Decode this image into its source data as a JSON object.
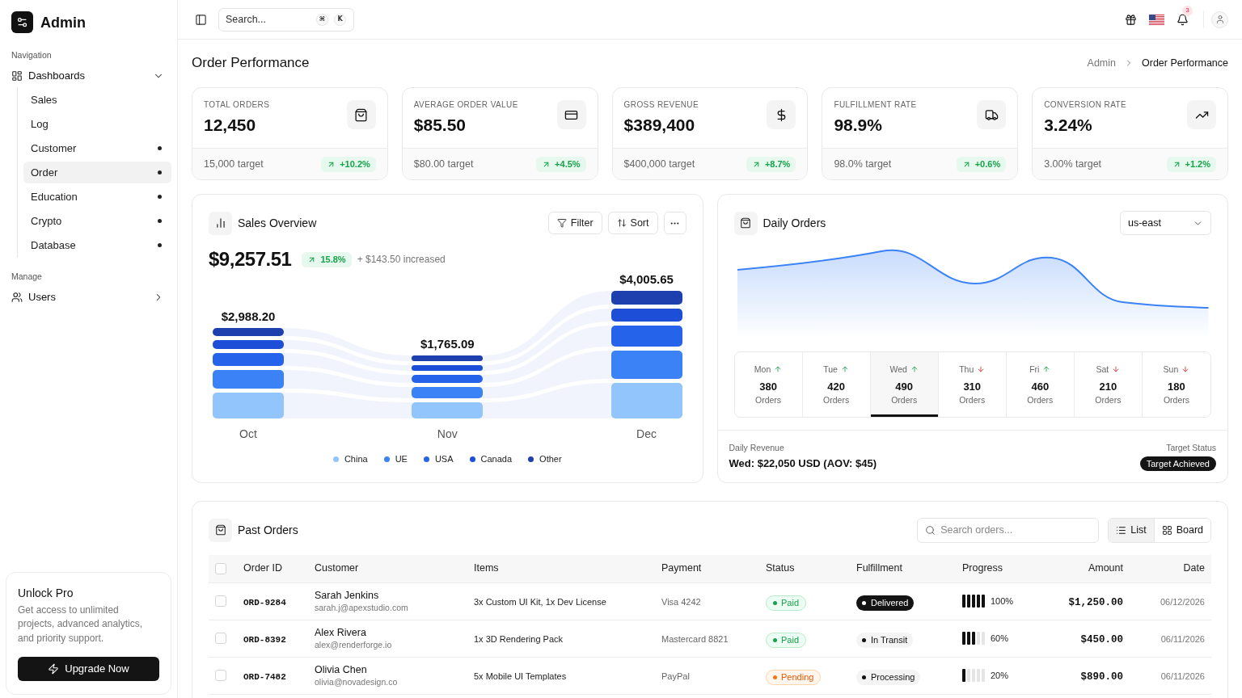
{
  "sidebar": {
    "brand": "Admin",
    "sections": [
      {
        "title": "Navigation",
        "items": [
          {
            "label": "Dashboards",
            "expanded": true,
            "children": [
              {
                "label": "Sales",
                "dot": false,
                "selected": false
              },
              {
                "label": "Log",
                "dot": false,
                "selected": false
              },
              {
                "label": "Customer",
                "dot": true,
                "selected": false
              },
              {
                "label": "Order",
                "dot": true,
                "selected": true
              },
              {
                "label": "Education",
                "dot": true,
                "selected": false
              },
              {
                "label": "Crypto",
                "dot": true,
                "selected": false
              },
              {
                "label": "Database",
                "dot": true,
                "selected": false
              }
            ]
          }
        ]
      },
      {
        "title": "Manage",
        "items": [
          {
            "label": "Users",
            "expanded": false
          }
        ]
      }
    ],
    "promo": {
      "title": "Unlock Pro",
      "text": "Get access to unlimited projects, advanced analytics, and priority support.",
      "button": "Upgrade Now"
    }
  },
  "header": {
    "search": {
      "placeholder": "Search...",
      "shortcut": [
        "⌘",
        "K"
      ]
    },
    "notifications": {
      "count": "3"
    }
  },
  "page": {
    "title": "Order Performance",
    "breadcrumb": [
      {
        "label": "Admin",
        "current": false
      },
      {
        "label": "Order Performance",
        "current": true
      }
    ]
  },
  "kpis": [
    {
      "label": "TOTAL ORDERS",
      "value": "12,450",
      "target": "15,000 target",
      "change": "+10.2%",
      "rising": true
    },
    {
      "label": "AVERAGE ORDER VALUE",
      "value": "$85.50",
      "target": "$80.00 target",
      "change": "+4.5%",
      "rising": true
    },
    {
      "label": "GROSS REVENUE",
      "value": "$389,400",
      "target": "$400,000 target",
      "change": "+8.7%",
      "rising": true
    },
    {
      "label": "FULFILLMENT RATE",
      "value": "98.9%",
      "target": "98.0% target",
      "change": "+0.6%",
      "rising": true
    },
    {
      "label": "CONVERSION RATE",
      "value": "3.24%",
      "target": "3.00% target",
      "change": "+1.2%",
      "rising": true
    }
  ],
  "sales_overview": {
    "title": "Sales Overview",
    "actions": [
      "Filter",
      "Sort"
    ],
    "total": "$9,257.51",
    "change": "15.8%",
    "rising": true,
    "note": "+ $143.50 increased",
    "columns": [
      {
        "label": "Oct",
        "total": "$2,988.20"
      },
      {
        "label": "Nov",
        "total": "$1,765.09"
      },
      {
        "label": "Dec",
        "total": "$4,005.65"
      }
    ],
    "legend": [
      {
        "label": "China",
        "color": "#93c5fd"
      },
      {
        "label": "UE",
        "color": "#3b82f6"
      },
      {
        "label": "USA",
        "color": "#2563eb"
      },
      {
        "label": "Canada",
        "color": "#1d4ed8"
      },
      {
        "label": "Other",
        "color": "#1e40af"
      }
    ]
  },
  "daily_orders": {
    "title": "Daily Orders",
    "region": {
      "value": "us-east"
    },
    "days": [
      {
        "day": "Mon",
        "rising": true,
        "count": "380",
        "unit": "Orders",
        "selected": false
      },
      {
        "day": "Tue",
        "rising": true,
        "count": "420",
        "unit": "Orders",
        "selected": false
      },
      {
        "day": "Wed",
        "rising": true,
        "count": "490",
        "unit": "Orders",
        "selected": true
      },
      {
        "day": "Thu",
        "rising": false,
        "count": "310",
        "unit": "Orders",
        "selected": false
      },
      {
        "day": "Fri",
        "rising": true,
        "count": "460",
        "unit": "Orders",
        "selected": false
      },
      {
        "day": "Sat",
        "rising": false,
        "count": "210",
        "unit": "Orders",
        "selected": false
      },
      {
        "day": "Sun",
        "rising": false,
        "count": "180",
        "unit": "Orders",
        "selected": false
      }
    ],
    "footer": {
      "label": "Daily Revenue",
      "value": "Wed: $22,050 USD (AOV: $45)",
      "status_label": "Target Status",
      "status": "Target Achieved"
    }
  },
  "past_orders": {
    "title": "Past Orders",
    "search": {
      "placeholder": "Search orders..."
    },
    "views": [
      {
        "label": "List",
        "selected": true
      },
      {
        "label": "Board",
        "selected": false
      }
    ],
    "table": {
      "all_checked": false,
      "columns": [
        "Order ID",
        "Customer",
        "Items",
        "Payment",
        "Status",
        "Fulfillment",
        "Progress",
        "Amount",
        "Date"
      ],
      "rows": [
        {
          "checked": false,
          "order_id": "ORD-9284",
          "customer": "Sarah Jenkins",
          "email": "sarah.j@apexstudio.com",
          "items": "3x Custom UI Kit, 1x Dev License",
          "payment": "Visa 4242",
          "status": {
            "label": "Paid",
            "kind": "paid"
          },
          "fulfillment": {
            "label": "Delivered",
            "kind": "delivered"
          },
          "progress": {
            "level": 1,
            "label": "100%"
          },
          "amount": "$1,250.00",
          "date": "06/12/2026"
        },
        {
          "checked": false,
          "order_id": "ORD-8392",
          "customer": "Alex Rivera",
          "email": "alex@renderforge.io",
          "items": "1x 3D Rendering Pack",
          "payment": "Mastercard 8821",
          "status": {
            "label": "Paid",
            "kind": "paid"
          },
          "fulfillment": {
            "label": "In Transit",
            "kind": "in_transit"
          },
          "progress": {
            "level": 0.6,
            "label": "60%"
          },
          "amount": "$450.00",
          "date": "06/11/2026"
        },
        {
          "checked": false,
          "order_id": "ORD-7482",
          "customer": "Olivia Chen",
          "email": "olivia@novadesign.co",
          "items": "5x Mobile UI Templates",
          "payment": "PayPal",
          "status": {
            "label": "Pending",
            "kind": "pending"
          },
          "fulfillment": {
            "label": "Processing",
            "kind": "processing"
          },
          "progress": {
            "level": 0.2,
            "label": "20%"
          },
          "amount": "$890.00",
          "date": "06/11/2026"
        }
      ]
    }
  }
}
